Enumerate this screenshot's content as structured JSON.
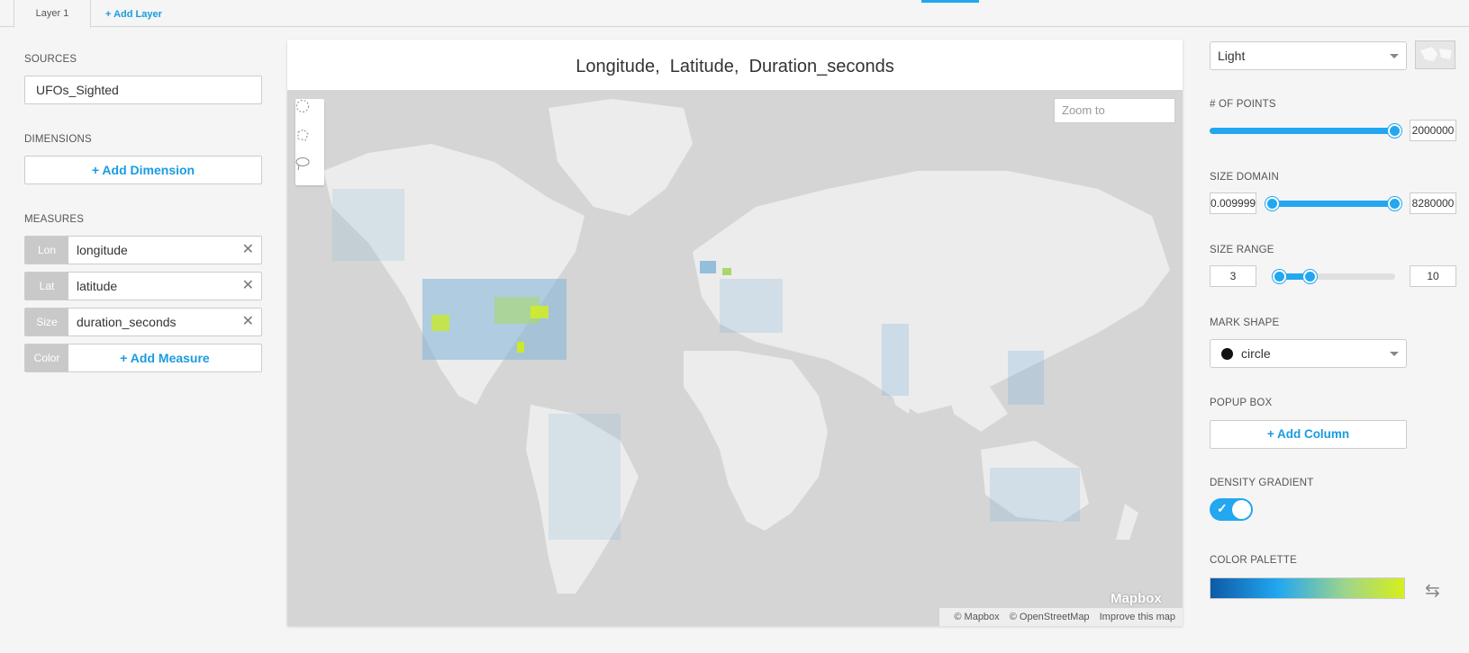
{
  "tabs": {
    "layer": "Layer 1",
    "add_layer": "+ Add Layer"
  },
  "left": {
    "sources_label": "SOURCES",
    "source_value": "UFOs_Sighted",
    "dimensions_label": "DIMENSIONS",
    "add_dimension": "+ Add Dimension",
    "measures_label": "MEASURES",
    "measures": [
      {
        "tag": "Lon",
        "value": "longitude"
      },
      {
        "tag": "Lat",
        "value": "latitude"
      },
      {
        "tag": "Size",
        "value": "duration_seconds"
      }
    ],
    "color_tag": "Color",
    "add_measure": "+ Add Measure",
    "remove_glyph": "✕"
  },
  "map": {
    "title": "Longitude,  Latitude,  Duration_seconds",
    "zoom_placeholder": "Zoom to",
    "logo": "Mapbox",
    "attribution": [
      "© Mapbox",
      "© OpenStreetMap",
      "Improve this map"
    ],
    "draw_tools": [
      "circle-select-icon",
      "polygon-select-icon",
      "lasso-select-icon"
    ]
  },
  "right": {
    "theme_value": "Light",
    "points_label": "# OF POINTS",
    "points_value": "2000000",
    "size_domain_label": "SIZE DOMAIN",
    "size_domain_min": "0.009999",
    "size_domain_max": "8280000",
    "size_range_label": "SIZE RANGE",
    "size_range_min": "3",
    "size_range_max": "10",
    "mark_shape_label": "MARK SHAPE",
    "mark_shape_value": "circle",
    "popup_label": "POPUP BOX",
    "add_column": "+ Add Column",
    "density_label": "DENSITY GRADIENT",
    "density_enabled": true,
    "palette_label": "COLOR PALETTE",
    "palette_colors": [
      "#0e5aa7",
      "#22a7f0",
      "#9fd58a",
      "#d6ef1a"
    ],
    "accent": "#22a7f0"
  }
}
